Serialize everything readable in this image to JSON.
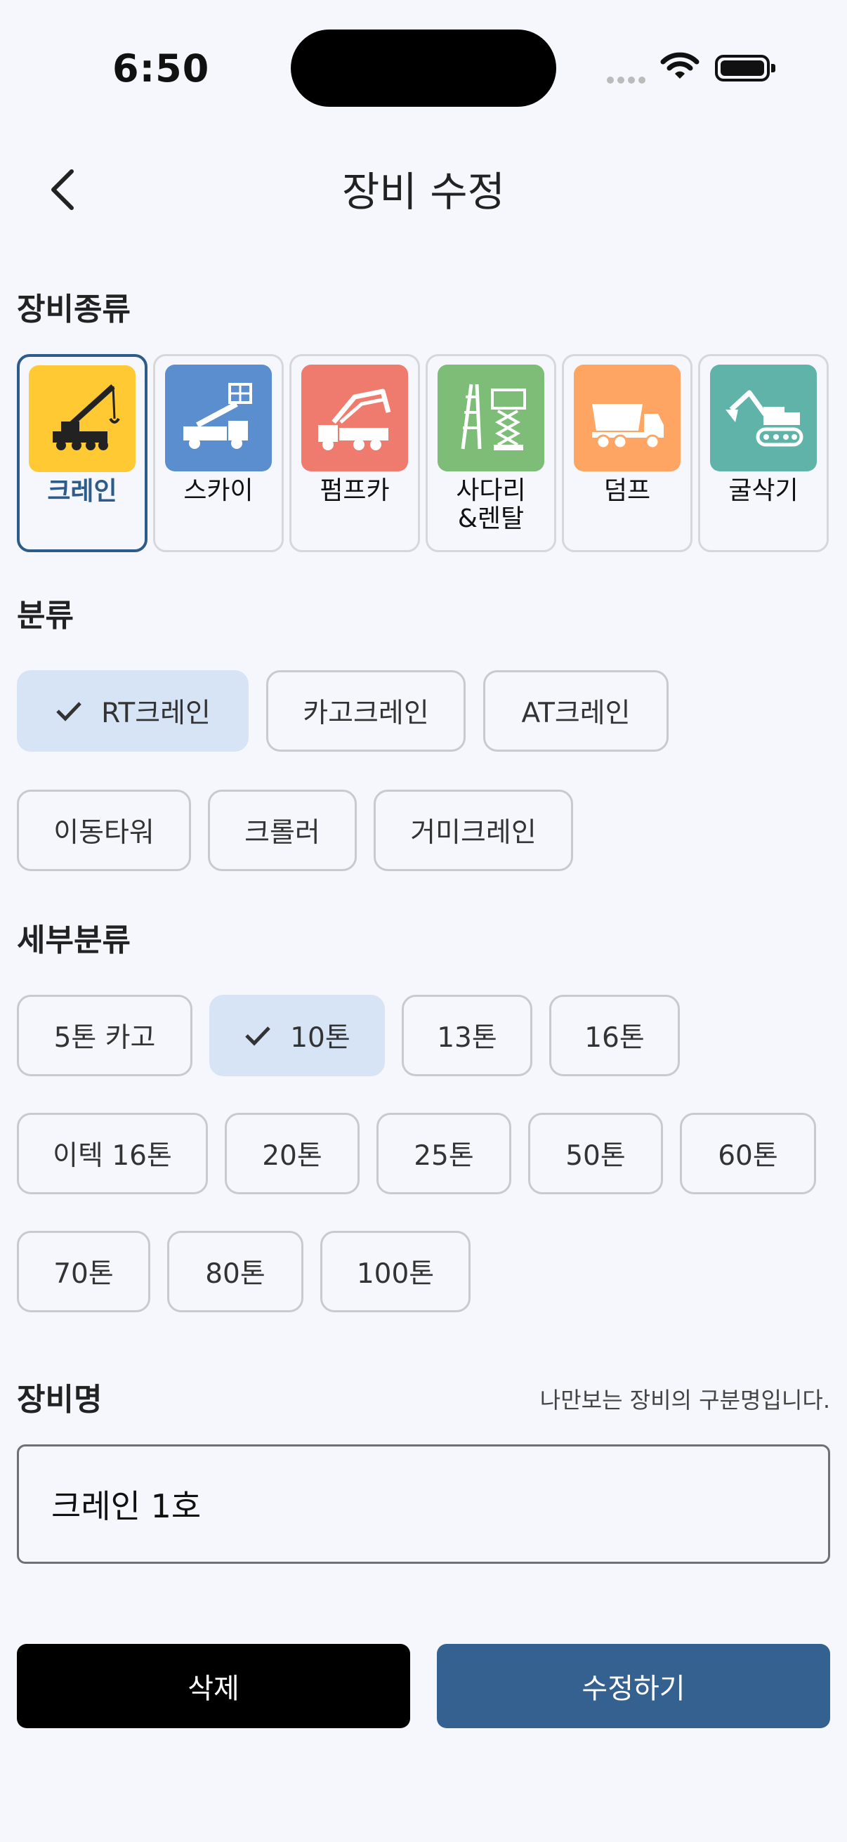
{
  "status": {
    "time": "6:50"
  },
  "header": {
    "title": "장비 수정"
  },
  "equipment_type": {
    "label": "장비종류",
    "items": [
      {
        "label": "크레인",
        "icon": "crane-icon",
        "color": "#ffc933",
        "selected": true
      },
      {
        "label": "스카이",
        "icon": "sky-lift-truck-icon",
        "color": "#5b8ecf",
        "selected": false
      },
      {
        "label": "펌프카",
        "icon": "pump-truck-icon",
        "color": "#ef7a6e",
        "selected": false
      },
      {
        "label": "사다리\n&렌탈",
        "icon": "ladder-scissor-lift-icon",
        "color": "#7dbd78",
        "selected": false
      },
      {
        "label": "덤프",
        "icon": "dump-truck-icon",
        "color": "#ffa564",
        "selected": false
      },
      {
        "label": "굴삭기",
        "icon": "excavator-icon",
        "color": "#5fb3a9",
        "selected": false
      }
    ]
  },
  "category": {
    "label": "분류",
    "items": [
      {
        "label": "RT크레인",
        "selected": true
      },
      {
        "label": "카고크레인",
        "selected": false
      },
      {
        "label": "AT크레인",
        "selected": false
      },
      {
        "label": "이동타워",
        "selected": false
      },
      {
        "label": "크롤러",
        "selected": false
      },
      {
        "label": "거미크레인",
        "selected": false
      }
    ]
  },
  "subcategory": {
    "label": "세부분류",
    "items": [
      {
        "label": "5톤 카고",
        "selected": false
      },
      {
        "label": "10톤",
        "selected": true
      },
      {
        "label": "13톤",
        "selected": false
      },
      {
        "label": "16톤",
        "selected": false
      },
      {
        "label": "이텍 16톤",
        "selected": false
      },
      {
        "label": "20톤",
        "selected": false
      },
      {
        "label": "25톤",
        "selected": false
      },
      {
        "label": "50톤",
        "selected": false
      },
      {
        "label": "60톤",
        "selected": false
      },
      {
        "label": "70톤",
        "selected": false
      },
      {
        "label": "80톤",
        "selected": false
      },
      {
        "label": "100톤",
        "selected": false
      }
    ]
  },
  "equipment_name": {
    "label": "장비명",
    "hint": "나만보는 장비의 구분명입니다.",
    "value": "크레인 1호"
  },
  "actions": {
    "delete_label": "삭제",
    "edit_label": "수정하기"
  },
  "colors": {
    "primary": "#34618f",
    "selected_chip": "#d7e4f6",
    "background": "#f6f7fd"
  }
}
